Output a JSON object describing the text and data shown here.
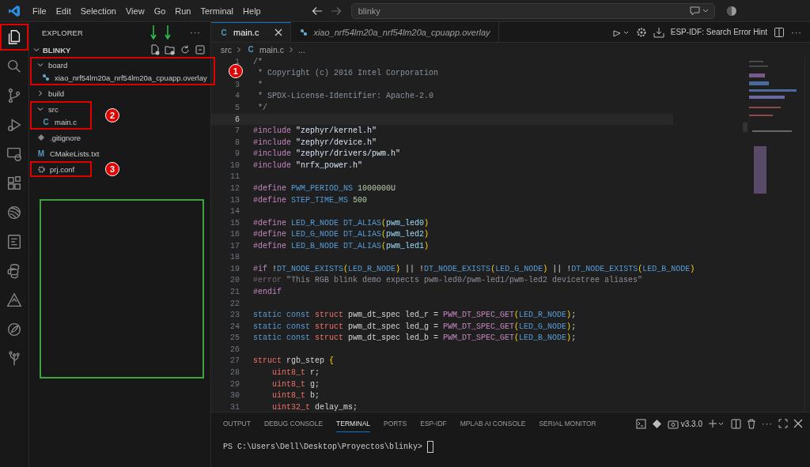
{
  "menu": [
    "File",
    "Edit",
    "Selection",
    "View",
    "Go",
    "Run",
    "Terminal",
    "Help"
  ],
  "command_center": {
    "value": "blinky"
  },
  "activity_bar": [
    {
      "kind": "files",
      "selected": true,
      "highlighted": true
    },
    {
      "kind": "search",
      "selected": false,
      "highlighted": false
    },
    {
      "kind": "branch",
      "selected": false,
      "highlighted": false
    },
    {
      "kind": "debug",
      "selected": false,
      "highlighted": false
    },
    {
      "kind": "remote",
      "selected": false,
      "highlighted": false
    },
    {
      "kind": "extensions",
      "selected": false,
      "highlighted": false
    },
    {
      "kind": "wave",
      "selected": false,
      "highlighted": false
    },
    {
      "kind": "board",
      "selected": false,
      "highlighted": false
    },
    {
      "kind": "python",
      "selected": false,
      "highlighted": false
    },
    {
      "kind": "triangle",
      "selected": false,
      "highlighted": false
    },
    {
      "kind": "leaf",
      "selected": false,
      "highlighted": false
    },
    {
      "kind": "tree",
      "selected": false,
      "highlighted": false
    }
  ],
  "sidebar": {
    "title": "EXPLORER",
    "more": "···",
    "folder": "BLINKY",
    "tree": [
      {
        "label": "board",
        "kind": "folder",
        "expanded": true,
        "highlighted": true,
        "badge": "1",
        "children": [
          {
            "label": "xiao_nrf54lm20a_nrf54lm20a_cpuapp.overlay",
            "kind": "overlay"
          }
        ]
      },
      {
        "label": "build",
        "kind": "folder",
        "expanded": false,
        "highlighted": false
      },
      {
        "label": "src",
        "kind": "folder",
        "expanded": true,
        "highlighted": true,
        "badge": "2",
        "children": [
          {
            "label": "main.c",
            "kind": "c",
            "icon_text": "C"
          }
        ]
      },
      {
        "label": ".gitignore",
        "kind": "git",
        "highlighted": false
      },
      {
        "label": "CMakeLists.txt",
        "kind": "cmake",
        "icon_text": "M",
        "highlighted": false
      },
      {
        "label": "prj.conf",
        "kind": "gear",
        "highlighted": true,
        "badge": "3"
      }
    ]
  },
  "tabs": [
    {
      "label": "main.c",
      "icon_text": "C",
      "selected": true,
      "italic": false
    },
    {
      "label": "xiao_nrf54lm20a_nrf54lm20a_cpuapp.overlay",
      "selected": false,
      "italic": true
    }
  ],
  "editor_actions": {
    "hint": "ESP-IDF: Search Error Hint",
    "more": "···"
  },
  "breadcrumb": [
    {
      "label": "src"
    },
    {
      "label": "main.c",
      "icon_text": "C"
    },
    {
      "label": "..."
    }
  ],
  "code": [
    {
      "n": "1",
      "current": false,
      "tokens": [
        {
          "t": "/*",
          "kind": "comment"
        }
      ]
    },
    {
      "current": false,
      "tokens": [
        {
          "t": " * Copyright (c) 2016 Intel Corporation",
          "kind": "comment"
        }
      ]
    },
    {
      "n": "3",
      "current": false,
      "tokens": [
        {
          "t": " *",
          "kind": "comment"
        }
      ]
    },
    {
      "n": "4",
      "current": false,
      "tokens": [
        {
          "t": " * SPDX-License-Identifier: Apache-2.0",
          "kind": "comment"
        }
      ]
    },
    {
      "n": "5",
      "current": false,
      "tokens": [
        {
          "t": " */",
          "kind": "comment"
        }
      ]
    },
    {
      "n": "6",
      "current": true
    },
    {
      "n": "7",
      "current": false,
      "tokens": [
        {
          "t": "#include ",
          "kind": "pre"
        },
        {
          "t": "\"zephyr/kernel.h\"",
          "kind": "str"
        }
      ]
    },
    {
      "n": "8",
      "current": false,
      "tokens": [
        {
          "t": "#include ",
          "kind": "pre"
        },
        {
          "t": "\"zephyr/device.h\"",
          "kind": "str"
        }
      ]
    },
    {
      "n": "9",
      "current": false,
      "tokens": [
        {
          "t": "#include ",
          "kind": "pre"
        },
        {
          "t": "\"zephyr/drivers/pwm.h\"",
          "kind": "str"
        }
      ]
    },
    {
      "n": "10",
      "current": false,
      "tokens": [
        {
          "t": "#include ",
          "kind": "pre"
        },
        {
          "t": "\"nrfx_power.h\"",
          "kind": "str"
        }
      ]
    },
    {
      "n": "11",
      "current": false
    },
    {
      "n": "12",
      "current": false,
      "tokens": [
        {
          "t": "#define ",
          "kind": "pre"
        },
        {
          "t": "PWM_PERIOD_NS ",
          "kind": "macro"
        },
        {
          "t": "1000000U",
          "kind": "num"
        }
      ]
    },
    {
      "n": "13",
      "current": false,
      "tokens": [
        {
          "t": "#define ",
          "kind": "pre"
        },
        {
          "t": "STEP_TIME_MS ",
          "kind": "macro"
        },
        {
          "t": "500",
          "kind": "num"
        }
      ]
    },
    {
      "n": "14",
      "current": false
    },
    {
      "n": "15",
      "current": false,
      "tokens": [
        {
          "t": "#define ",
          "kind": "pre"
        },
        {
          "t": "LED_R_NODE DT_ALIAS",
          "kind": "macro"
        },
        {
          "t": "(",
          "kind": "paren"
        },
        {
          "t": "pwm_led0",
          "kind": "param"
        },
        {
          "t": ")",
          "kind": "paren"
        }
      ]
    },
    {
      "n": "16",
      "current": false,
      "tokens": [
        {
          "t": "#define ",
          "kind": "pre"
        },
        {
          "t": "LED_G_NODE DT_ALIAS",
          "kind": "macro"
        },
        {
          "t": "(",
          "kind": "paren"
        },
        {
          "t": "pwm_led2",
          "kind": "param"
        },
        {
          "t": ")",
          "kind": "paren"
        }
      ]
    },
    {
      "n": "17",
      "current": false,
      "tokens": [
        {
          "t": "#define ",
          "kind": "pre"
        },
        {
          "t": "LED_B_NODE DT_ALIAS",
          "kind": "macro"
        },
        {
          "t": "(",
          "kind": "paren"
        },
        {
          "t": "pwm_led1",
          "kind": "param"
        },
        {
          "t": ")",
          "kind": "paren"
        }
      ]
    },
    {
      "n": "18",
      "current": false
    },
    {
      "n": "19",
      "current": false,
      "tokens": [
        {
          "t": "#if ",
          "kind": "pre"
        },
        {
          "t": "!",
          "kind": "plain"
        },
        {
          "t": "DT_NODE_EXISTS",
          "kind": "macro"
        },
        {
          "t": "(",
          "kind": "paren"
        },
        {
          "t": "LED_R_NODE",
          "kind": "macro"
        },
        {
          "t": ")",
          "kind": "paren"
        },
        {
          "t": " || !",
          "kind": "plain"
        },
        {
          "t": "DT_NODE_EXISTS",
          "kind": "macro"
        },
        {
          "t": "(",
          "kind": "paren"
        },
        {
          "t": "LED_G_NODE",
          "kind": "macro"
        },
        {
          "t": ")",
          "kind": "paren"
        },
        {
          "t": " || !",
          "kind": "plain"
        },
        {
          "t": "DT_NODE_EXISTS",
          "kind": "macro"
        },
        {
          "t": "(",
          "kind": "paren"
        },
        {
          "t": "LED_B_NODE",
          "kind": "macro"
        },
        {
          "t": ")",
          "kind": "paren"
        }
      ]
    },
    {
      "n": "20",
      "current": false,
      "tokens": [
        {
          "t": "#error ",
          "kind": "dimpre"
        },
        {
          "t": "\"This RGB blink demo expects pwm-led0/pwm-led1/pwm-led2 devicetree aliases\"",
          "kind": "dim"
        }
      ]
    },
    {
      "n": "21",
      "current": false,
      "tokens": [
        {
          "t": "#endif",
          "kind": "pre"
        }
      ]
    },
    {
      "n": "22",
      "current": false
    },
    {
      "n": "23",
      "current": false,
      "tokens": [
        {
          "t": "static const ",
          "kind": "kw"
        },
        {
          "t": "struct ",
          "kind": "type"
        },
        {
          "t": "pwm_dt_spec led_r = ",
          "kind": "plain"
        },
        {
          "t": "PWM_DT_SPEC_GET",
          "kind": "fn"
        },
        {
          "t": "(",
          "kind": "paren"
        },
        {
          "t": "LED_R_NODE",
          "kind": "macro"
        },
        {
          "t": ")",
          "kind": "paren"
        },
        {
          "t": ";",
          "kind": "plain"
        }
      ]
    },
    {
      "n": "24",
      "current": false,
      "tokens": [
        {
          "t": "static const ",
          "kind": "kw"
        },
        {
          "t": "struct ",
          "kind": "type"
        },
        {
          "t": "pwm_dt_spec led_g = ",
          "kind": "plain"
        },
        {
          "t": "PWM_DT_SPEC_GET",
          "kind": "fn"
        },
        {
          "t": "(",
          "kind": "paren"
        },
        {
          "t": "LED_G_NODE",
          "kind": "macro"
        },
        {
          "t": ")",
          "kind": "paren"
        },
        {
          "t": ";",
          "kind": "plain"
        }
      ]
    },
    {
      "n": "25",
      "current": false,
      "tokens": [
        {
          "t": "static const ",
          "kind": "kw"
        },
        {
          "t": "struct ",
          "kind": "type"
        },
        {
          "t": "pwm_dt_spec led_b = ",
          "kind": "plain"
        },
        {
          "t": "PWM_DT_SPEC_GET",
          "kind": "fn"
        },
        {
          "t": "(",
          "kind": "paren"
        },
        {
          "t": "LED_B_NODE",
          "kind": "macro"
        },
        {
          "t": ")",
          "kind": "paren"
        },
        {
          "t": ";",
          "kind": "plain"
        }
      ]
    },
    {
      "n": "26",
      "current": false
    },
    {
      "n": "27",
      "current": false,
      "tokens": [
        {
          "t": "struct ",
          "kind": "type"
        },
        {
          "t": "rgb_step ",
          "kind": "plain"
        },
        {
          "t": "{",
          "kind": "paren"
        }
      ]
    },
    {
      "n": "28",
      "current": false,
      "tokens": [
        {
          "t": "    uint8_t ",
          "kind": "type"
        },
        {
          "t": "r;",
          "kind": "plain"
        }
      ]
    },
    {
      "n": "29",
      "current": false,
      "tokens": [
        {
          "t": "    uint8_t ",
          "kind": "type"
        },
        {
          "t": "g;",
          "kind": "plain"
        }
      ]
    },
    {
      "n": "30",
      "current": false,
      "tokens": [
        {
          "t": "    uint8_t ",
          "kind": "type"
        },
        {
          "t": "b;",
          "kind": "plain"
        }
      ]
    },
    {
      "n": "31",
      "current": false,
      "tokens": [
        {
          "t": "    uint32_t ",
          "kind": "type"
        },
        {
          "t": "delay_ms;",
          "kind": "plain"
        }
      ]
    }
  ],
  "panel": {
    "tabs": [
      {
        "label": "OUTPUT",
        "selected": false
      },
      {
        "label": "DEBUG CONSOLE",
        "selected": false
      },
      {
        "label": "TERMINAL",
        "selected": true
      },
      {
        "label": "PORTS",
        "selected": false
      },
      {
        "label": "ESP-IDF",
        "selected": false
      },
      {
        "label": "MPLAB AI CONSOLE",
        "selected": false
      },
      {
        "label": "SERIAL MONITOR",
        "selected": false
      }
    ],
    "version": "v3.3.0",
    "more": "···",
    "prompt": "PS C:\\Users\\Dell\\Desktop\\Proyectos\\blinky> "
  }
}
